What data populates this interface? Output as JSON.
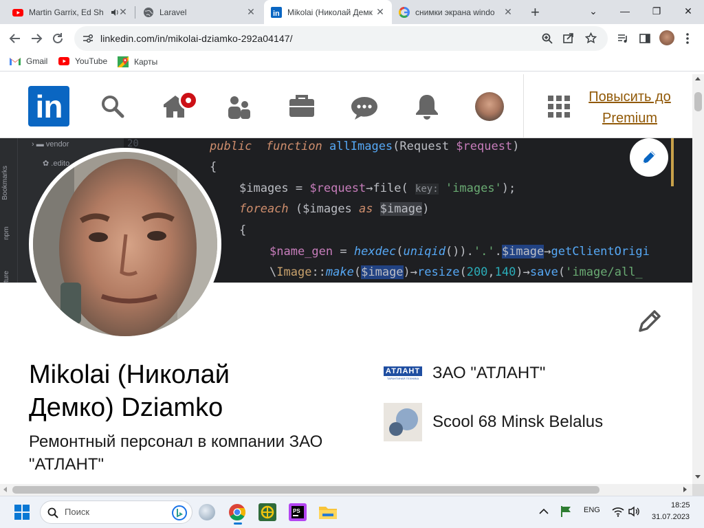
{
  "browser": {
    "tabs": [
      {
        "title": "Martin Garrix, Ed Sh",
        "favicon": "youtube-icon",
        "audio": true
      },
      {
        "title": "Laravel",
        "favicon": "globe-icon"
      },
      {
        "title": "Mikolai (Николай Демк",
        "favicon": "linkedin-icon",
        "active": true
      },
      {
        "title": "снимки экрана windo",
        "favicon": "google-icon"
      }
    ],
    "url": "linkedin.com/in/mikolai-dziamko-292a04147/",
    "bookmarks": [
      {
        "label": "Gmail",
        "icon": "gmail-icon"
      },
      {
        "label": "YouTube",
        "icon": "youtube-icon"
      },
      {
        "label": "Карты",
        "icon": "maps-icon"
      }
    ]
  },
  "linkedin": {
    "logo_text": "in",
    "premium_label": "Повысить до Premium",
    "home_badge_color": "#cc1016"
  },
  "banner_code": {
    "gutter_items": [
      "vendor",
      ".edito",
      "Bookmarks",
      "npm",
      "ture"
    ],
    "line_number": "20"
  },
  "profile": {
    "name": "Mikolai (Николай Демко) Dziamko",
    "headline": "Ремонтный персонал в компании ЗАО \"АТЛАНТ\"",
    "orgs": [
      {
        "name": "ЗАО \"АТЛАНТ\"",
        "logo": "atlant-logo",
        "logo_text": "АТЛАНТ",
        "logo_subtext": "ТАРАНТИНАЯ ТЕХНИКА"
      },
      {
        "name": "Scool 68 Minsk Belalus",
        "logo": "school-logo"
      }
    ]
  },
  "taskbar": {
    "search_placeholder": "Поиск",
    "language": "ENG",
    "time": "18:25",
    "date": "31.07.2023"
  },
  "colors": {
    "linkedin_blue": "#0a66c2",
    "premium_gold": "#915907",
    "code_bg": "#1e1f22"
  }
}
